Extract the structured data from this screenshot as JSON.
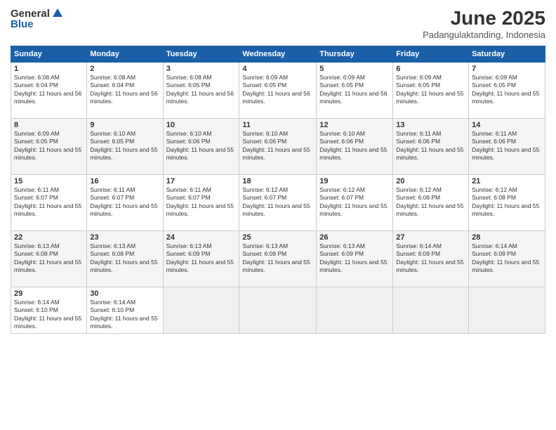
{
  "header": {
    "logo_line1": "General",
    "logo_line2": "Blue",
    "month_year": "June 2025",
    "location": "Padangulaktanding, Indonesia"
  },
  "weekdays": [
    "Sunday",
    "Monday",
    "Tuesday",
    "Wednesday",
    "Thursday",
    "Friday",
    "Saturday"
  ],
  "weeks": [
    [
      {
        "day": "1",
        "sunrise": "6:08 AM",
        "sunset": "6:04 PM",
        "daylight": "11 hours and 56 minutes."
      },
      {
        "day": "2",
        "sunrise": "6:08 AM",
        "sunset": "6:04 PM",
        "daylight": "11 hours and 56 minutes."
      },
      {
        "day": "3",
        "sunrise": "6:08 AM",
        "sunset": "6:05 PM",
        "daylight": "11 hours and 56 minutes."
      },
      {
        "day": "4",
        "sunrise": "6:09 AM",
        "sunset": "6:05 PM",
        "daylight": "11 hours and 56 minutes."
      },
      {
        "day": "5",
        "sunrise": "6:09 AM",
        "sunset": "6:05 PM",
        "daylight": "11 hours and 56 minutes."
      },
      {
        "day": "6",
        "sunrise": "6:09 AM",
        "sunset": "6:05 PM",
        "daylight": "11 hours and 55 minutes."
      },
      {
        "day": "7",
        "sunrise": "6:09 AM",
        "sunset": "6:05 PM",
        "daylight": "11 hours and 55 minutes."
      }
    ],
    [
      {
        "day": "8",
        "sunrise": "6:09 AM",
        "sunset": "6:05 PM",
        "daylight": "11 hours and 55 minutes."
      },
      {
        "day": "9",
        "sunrise": "6:10 AM",
        "sunset": "6:05 PM",
        "daylight": "11 hours and 55 minutes."
      },
      {
        "day": "10",
        "sunrise": "6:10 AM",
        "sunset": "6:06 PM",
        "daylight": "11 hours and 55 minutes."
      },
      {
        "day": "11",
        "sunrise": "6:10 AM",
        "sunset": "6:06 PM",
        "daylight": "11 hours and 55 minutes."
      },
      {
        "day": "12",
        "sunrise": "6:10 AM",
        "sunset": "6:06 PM",
        "daylight": "11 hours and 55 minutes."
      },
      {
        "day": "13",
        "sunrise": "6:11 AM",
        "sunset": "6:06 PM",
        "daylight": "11 hours and 55 minutes."
      },
      {
        "day": "14",
        "sunrise": "6:11 AM",
        "sunset": "6:06 PM",
        "daylight": "11 hours and 55 minutes."
      }
    ],
    [
      {
        "day": "15",
        "sunrise": "6:11 AM",
        "sunset": "6:07 PM",
        "daylight": "11 hours and 55 minutes."
      },
      {
        "day": "16",
        "sunrise": "6:11 AM",
        "sunset": "6:07 PM",
        "daylight": "11 hours and 55 minutes."
      },
      {
        "day": "17",
        "sunrise": "6:11 AM",
        "sunset": "6:07 PM",
        "daylight": "11 hours and 55 minutes."
      },
      {
        "day": "18",
        "sunrise": "6:12 AM",
        "sunset": "6:07 PM",
        "daylight": "11 hours and 55 minutes."
      },
      {
        "day": "19",
        "sunrise": "6:12 AM",
        "sunset": "6:07 PM",
        "daylight": "11 hours and 55 minutes."
      },
      {
        "day": "20",
        "sunrise": "6:12 AM",
        "sunset": "6:08 PM",
        "daylight": "11 hours and 55 minutes."
      },
      {
        "day": "21",
        "sunrise": "6:12 AM",
        "sunset": "6:08 PM",
        "daylight": "11 hours and 55 minutes."
      }
    ],
    [
      {
        "day": "22",
        "sunrise": "6:13 AM",
        "sunset": "6:08 PM",
        "daylight": "11 hours and 55 minutes."
      },
      {
        "day": "23",
        "sunrise": "6:13 AM",
        "sunset": "6:08 PM",
        "daylight": "11 hours and 55 minutes."
      },
      {
        "day": "24",
        "sunrise": "6:13 AM",
        "sunset": "6:09 PM",
        "daylight": "11 hours and 55 minutes."
      },
      {
        "day": "25",
        "sunrise": "6:13 AM",
        "sunset": "6:09 PM",
        "daylight": "11 hours and 55 minutes."
      },
      {
        "day": "26",
        "sunrise": "6:13 AM",
        "sunset": "6:09 PM",
        "daylight": "11 hours and 55 minutes."
      },
      {
        "day": "27",
        "sunrise": "6:14 AM",
        "sunset": "6:09 PM",
        "daylight": "11 hours and 55 minutes."
      },
      {
        "day": "28",
        "sunrise": "6:14 AM",
        "sunset": "6:09 PM",
        "daylight": "11 hours and 55 minutes."
      }
    ],
    [
      {
        "day": "29",
        "sunrise": "6:14 AM",
        "sunset": "6:10 PM",
        "daylight": "11 hours and 55 minutes."
      },
      {
        "day": "30",
        "sunrise": "6:14 AM",
        "sunset": "6:10 PM",
        "daylight": "11 hours and 55 minutes."
      },
      null,
      null,
      null,
      null,
      null
    ]
  ]
}
